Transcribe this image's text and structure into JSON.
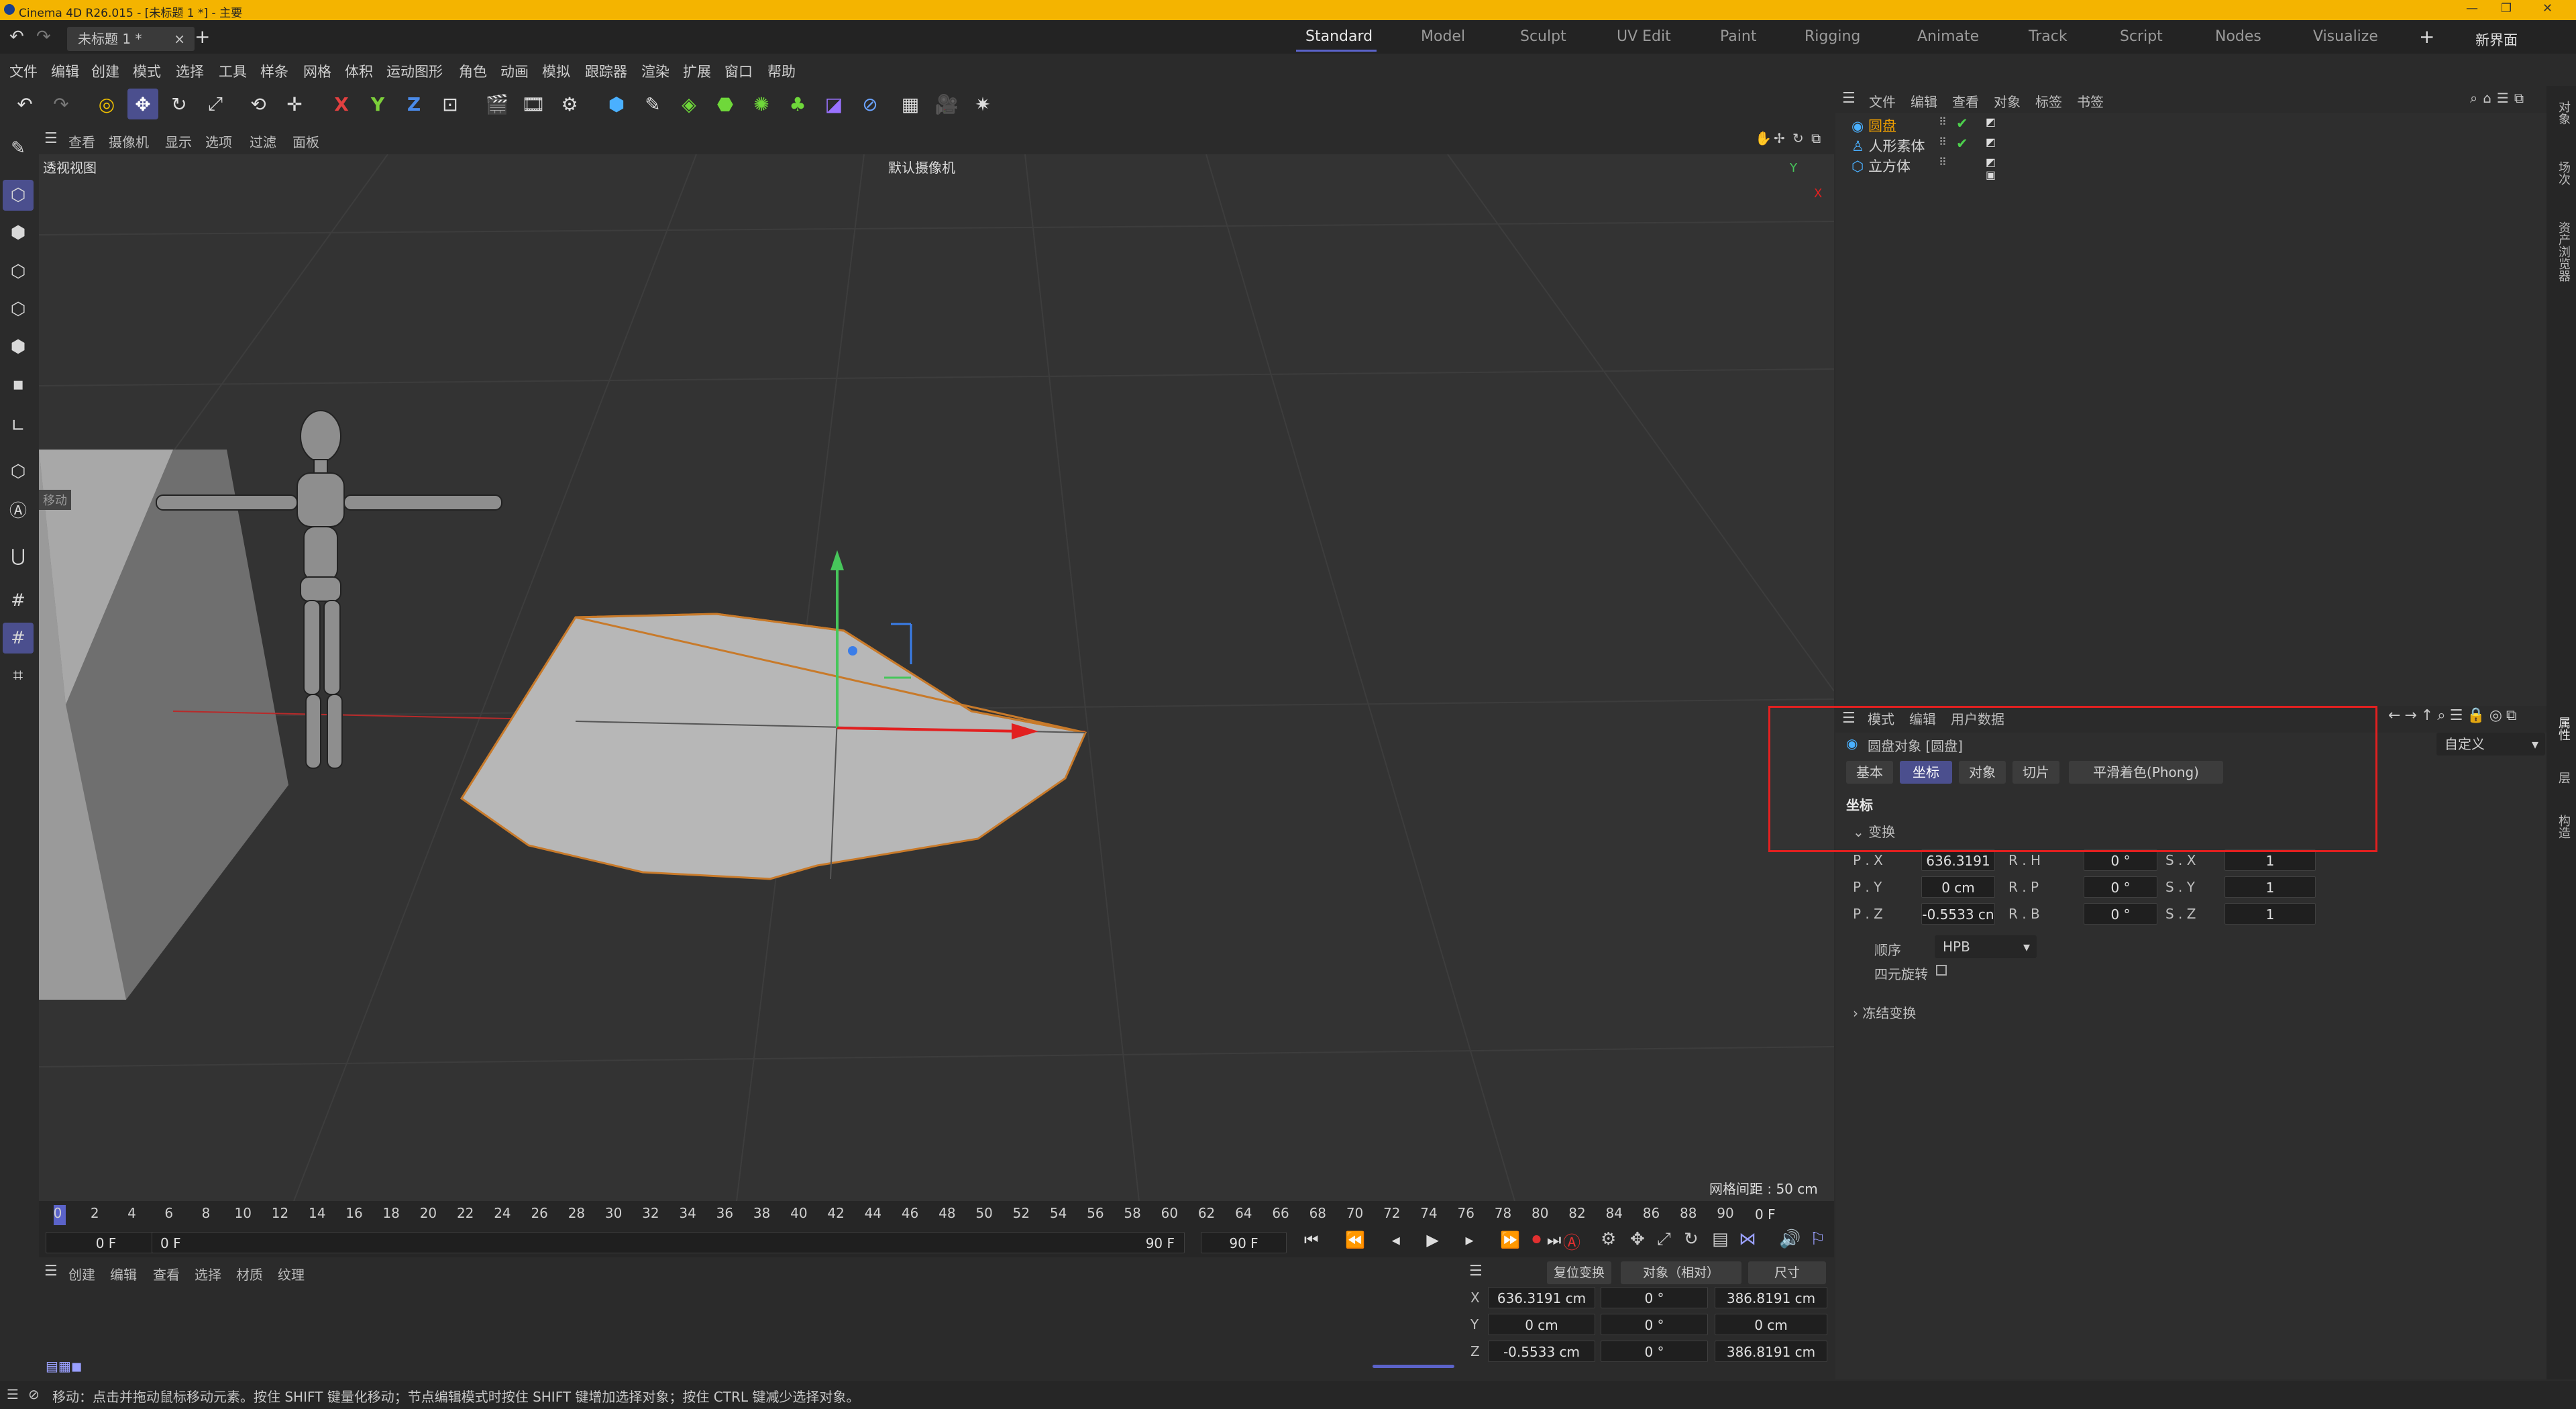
{
  "titlebar": {
    "title": "Cinema 4D R26.015 - [未标题 1 *] - 主要"
  },
  "tabbar": {
    "document_tab": "未标题 1 *",
    "close": "×",
    "add": "+",
    "layouts": [
      "Standard",
      "Model",
      "Sculpt",
      "UV Edit",
      "Paint",
      "Rigging",
      "Animate",
      "Track",
      "Script",
      "Nodes",
      "Visualize"
    ],
    "add_layout": "+",
    "new_layout": "新界面"
  },
  "menu": [
    "文件",
    "编辑",
    "创建",
    "模式",
    "选择",
    "工具",
    "样条",
    "网格",
    "体积",
    "运动图形",
    "角色",
    "动画",
    "模拟",
    "跟踪器",
    "渲染",
    "扩展",
    "窗口",
    "帮助"
  ],
  "toolbar": {
    "axis_x": "X",
    "axis_y": "Y",
    "axis_z": "Z"
  },
  "viewport": {
    "menu": [
      "查看",
      "摄像机",
      "显示",
      "选项",
      "过滤",
      "面板"
    ],
    "name": "透视视图",
    "camera": "默认摄像机",
    "grid_distance": "网格间距 : 50 cm",
    "move_label": "移动",
    "gizmo_x": "X",
    "gizmo_y": "Y"
  },
  "object_manager": {
    "menu": [
      "文件",
      "编辑",
      "查看",
      "对象",
      "标签",
      "书签"
    ],
    "objects": [
      {
        "name": "圆盘",
        "selected": true
      },
      {
        "name": "人形素体",
        "selected": false
      },
      {
        "name": "立方体",
        "selected": false
      }
    ]
  },
  "attributes": {
    "menu": [
      "模式",
      "编辑",
      "用户数据"
    ],
    "object_title": "圆盘对象 [圆盘]",
    "preset": "自定义",
    "tabs": [
      "基本",
      "坐标",
      "对象",
      "切片",
      "平滑着色(Phong)"
    ],
    "active_tab": "坐标",
    "section": "坐标",
    "group": "变换",
    "rows": [
      {
        "p_label": "P . X",
        "p_value": "636.3191 c",
        "r_label": "R . H",
        "r_value": "0 °",
        "s_label": "S . X",
        "s_value": "1"
      },
      {
        "p_label": "P . Y",
        "p_value": "0 cm",
        "r_label": "R . P",
        "r_value": "0 °",
        "s_label": "S . Y",
        "s_value": "1"
      },
      {
        "p_label": "P . Z",
        "p_value": "-0.5533 cn",
        "r_label": "R . B",
        "r_value": "0 °",
        "s_label": "S . Z",
        "s_value": "1"
      }
    ],
    "order_label": "顺序",
    "order_value": "HPB",
    "quaternion_label": "四元旋转",
    "freeze": "冻结变换"
  },
  "timeline": {
    "ticks": [
      "0",
      "2",
      "4",
      "6",
      "8",
      "10",
      "12",
      "14",
      "16",
      "18",
      "20",
      "22",
      "24",
      "26",
      "28",
      "30",
      "32",
      "34",
      "36",
      "38",
      "40",
      "42",
      "44",
      "46",
      "48",
      "50",
      "52",
      "54",
      "56",
      "58",
      "60",
      "62",
      "64",
      "66",
      "68",
      "70",
      "72",
      "74",
      "76",
      "78",
      "80",
      "82",
      "84",
      "86",
      "88",
      "90"
    ],
    "current_frame": "0 F",
    "start": "0 F",
    "range_start": "0 F",
    "range_end": "90 F",
    "end": "90 F"
  },
  "material_manager": {
    "menu": [
      "创建",
      "编辑",
      "查看",
      "选择",
      "材质",
      "纹理"
    ]
  },
  "coord_manager": {
    "reset": "复位变换",
    "mode": "对象（相对）",
    "size_mode": "尺寸",
    "rows": [
      {
        "axis": "X",
        "pos": "636.3191 cm",
        "rot": "0 °",
        "size": "386.8191 cm"
      },
      {
        "axis": "Y",
        "pos": "0 cm",
        "rot": "0 °",
        "size": "0 cm"
      },
      {
        "axis": "Z",
        "pos": "-0.5533 cm",
        "rot": "0 °",
        "size": "386.8191 cm"
      }
    ]
  },
  "side_tabs": [
    "对象",
    "场次",
    "资产浏览器",
    "属性",
    "层",
    "构造"
  ],
  "status": {
    "text": "移动：点击并拖动鼠标移动元素。按住 SHIFT 键量化移动；节点编辑模式时按住 SHIFT 键增加选择对象；按住 CTRL 键减少选择对象。"
  },
  "colors": {
    "title": "#f4b400",
    "accent": "#5b63c9",
    "highlight": "#e22020",
    "selected_object": "#f0a000"
  }
}
